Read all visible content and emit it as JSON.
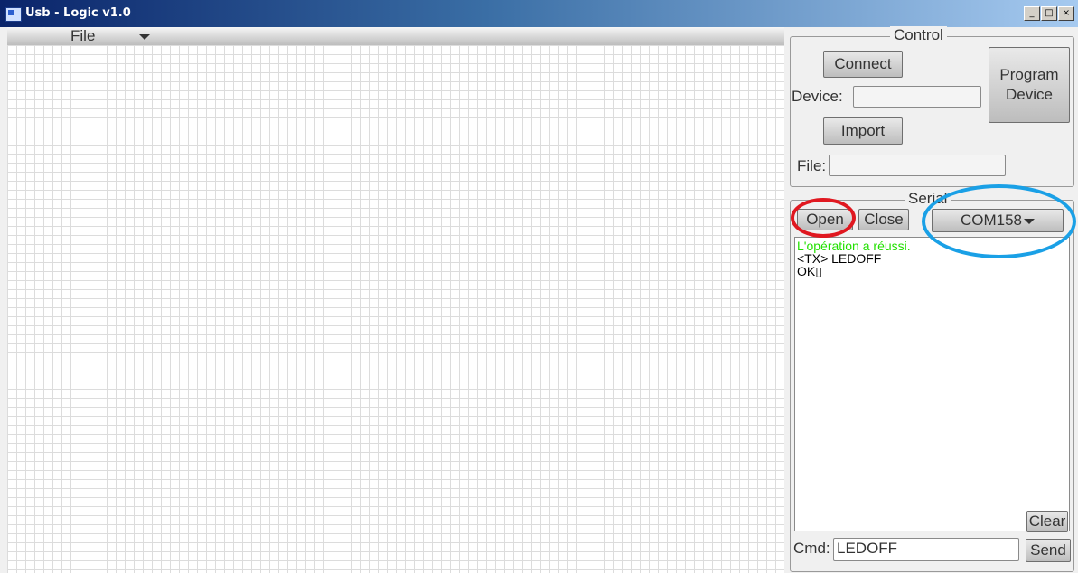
{
  "window": {
    "title": "Usb - Logic v1.0",
    "controls": [
      "_",
      "□",
      "×"
    ]
  },
  "menubar": {
    "file_label": "File"
  },
  "control": {
    "group_title": "Control",
    "connect_label": "Connect",
    "program_label_line1": "Program",
    "program_label_line2": "Device",
    "device_label": "Device:",
    "device_value": "",
    "import_label": "Import",
    "file_label": "File:",
    "file_value": ""
  },
  "serial": {
    "group_title": "Serial",
    "open_label": "Open",
    "close_label": "Close",
    "port_selected": "COM158",
    "console_lines": [
      {
        "text": "L'opération a réussi.",
        "color": "#22e000"
      },
      {
        "text": "<TX>  LEDOFF",
        "color": "#000000"
      },
      {
        "text": "OK▯",
        "color": "#000000"
      }
    ],
    "clear_label": "Clear",
    "cmd_label": "Cmd:",
    "cmd_value": "LEDOFF",
    "send_label": "Send"
  },
  "annotations": {
    "red_circle_color": "#e01820",
    "blue_circle_color": "#1aa0e6"
  }
}
